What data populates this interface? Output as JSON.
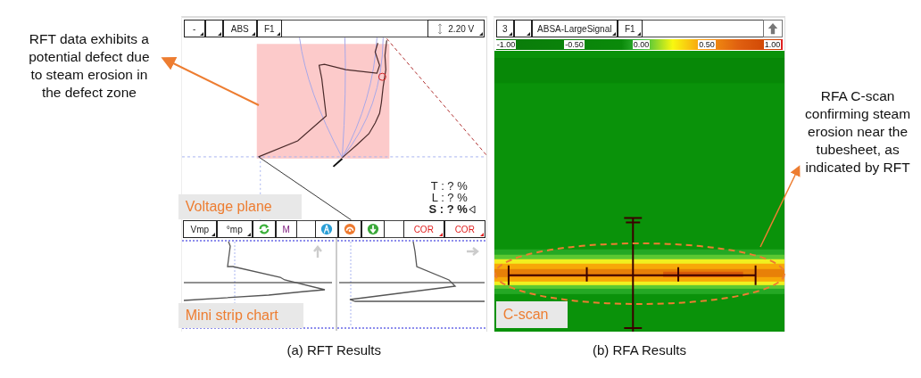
{
  "notes": [
    {
      "text": "RFT data exhibits a potential defect due to steam erosion in the defect zone"
    },
    {
      "text": "RFA C-scan confirming steam erosion near the tubesheet, as indicated by RFT"
    }
  ],
  "rft": {
    "toolbar": [
      {
        "kind": "dropdown",
        "label": "-"
      },
      {
        "kind": "dropdown"
      },
      {
        "kind": "dropdown",
        "label": "ABS"
      },
      {
        "kind": "dropdown",
        "label": "F1"
      },
      {
        "kind": "spacer"
      },
      {
        "kind": "scale",
        "label": "2.20 V"
      }
    ],
    "readouts": [
      {
        "text": "T : ? %",
        "selected": false
      },
      {
        "text": "L : ? %",
        "selected": false
      },
      {
        "text": "S : ? %",
        "selected": true
      }
    ],
    "plane_label": "Voltage plane",
    "controls": [
      {
        "kind": "dropdown",
        "label": "Vmp"
      },
      {
        "kind": "dropdown",
        "label": "°mp"
      },
      {
        "kind": "refresh"
      },
      {
        "kind": "button",
        "label": "M"
      },
      {
        "kind": "spacer"
      },
      {
        "kind": "tools"
      },
      {
        "kind": "spacer"
      },
      {
        "kind": "red-dropdown",
        "label": "COR"
      },
      {
        "kind": "red-dropdown",
        "label": "COR"
      }
    ],
    "strip_label": "Mini strip chart",
    "caption": "(a) RFT Results"
  },
  "rfa": {
    "toolbar": [
      {
        "kind": "dropdown",
        "label": "3"
      },
      {
        "kind": "dropdown"
      },
      {
        "kind": "dropdown",
        "label": "ABSA-LargeSignal"
      },
      {
        "kind": "dropdown",
        "label": "F1"
      },
      {
        "kind": "spacer"
      },
      {
        "kind": "up"
      }
    ],
    "legend_ticks": [
      "-1.00",
      "-0.50",
      "0.00",
      "0.50",
      "1.00"
    ],
    "scan_label": "C-scan",
    "caption": "(b) RFA Results"
  }
}
